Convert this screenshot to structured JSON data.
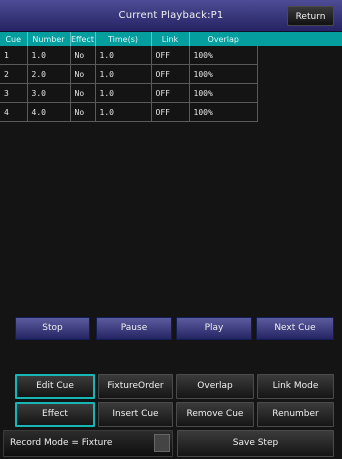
{
  "title_bar": {
    "title": "Current Playback:P1",
    "return_label": "Return"
  },
  "cue_table": {
    "headers": [
      "Cue",
      "Number",
      "Effect",
      "Time(s)",
      "Link",
      "Overlap"
    ],
    "rows": [
      [
        "1",
        "1.0",
        "No",
        "1.0",
        "OFF",
        "100%"
      ],
      [
        "2",
        "2.0",
        "No",
        "1.0",
        "OFF",
        "100%"
      ],
      [
        "3",
        "3.0",
        "No",
        "1.0",
        "OFF",
        "100%"
      ],
      [
        "4",
        "4.0",
        "No",
        "1.0",
        "OFF",
        "100%"
      ]
    ]
  },
  "playback_controls": {
    "stop": "Stop",
    "pause": "Pause",
    "play": "Play",
    "next_cue": "Next Cue"
  },
  "cue_actions": {
    "edit_cue": "Edit Cue",
    "fixture_order": "FixtureOrder",
    "overlap": "Overlap",
    "link_mode": "Link Mode",
    "effect": "Effect",
    "insert_cue": "Insert Cue",
    "remove_cue": "Remove Cue",
    "renumber": "Renumber"
  },
  "footer": {
    "record_mode": "Record Mode = Fixture",
    "save_step": "Save Step"
  },
  "colors": {
    "title_bar": "#2e2b6d",
    "table_header": "#049e9f",
    "selected_outline": "#16b5b6"
  }
}
